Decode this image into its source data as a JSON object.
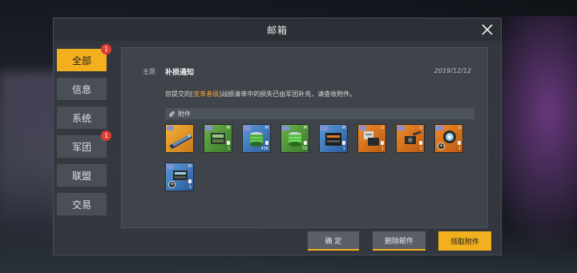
{
  "dialog": {
    "title": "邮箱",
    "close_icon": "close-icon"
  },
  "tabs": [
    {
      "label": "全部",
      "active": true,
      "badge": "1"
    },
    {
      "label": "信息",
      "active": false,
      "badge": ""
    },
    {
      "label": "系统",
      "active": false,
      "badge": ""
    },
    {
      "label": "军团",
      "active": false,
      "badge": "1"
    },
    {
      "label": "联盟",
      "active": false,
      "badge": ""
    },
    {
      "label": "交易",
      "active": false,
      "badge": ""
    }
  ],
  "mail": {
    "subject_label": "主题",
    "subject": "补损通知",
    "date": "2019/12/12",
    "message_prefix": "您提交的[",
    "message_highlight": "变革者级",
    "message_suffix": "]战损清单中的损失已由军团补充，请查收附件。",
    "attachment_label": "附件",
    "attachment_icon": "paperclip-icon"
  },
  "attachments": [
    {
      "name": "ship-blueprint-item",
      "rank": "",
      "qty": "",
      "color": "#f0a020"
    },
    {
      "name": "green-module-item",
      "rank": "M",
      "qty": "1",
      "color": "#4a9a3a"
    },
    {
      "name": "blue-coil-item",
      "rank": "M",
      "qty": "438",
      "color": "#3a78c0"
    },
    {
      "name": "green-coil-item",
      "rank": "M",
      "qty": "79",
      "color": "#4a9a3a"
    },
    {
      "name": "blue-engine-item",
      "rank": "M",
      "qty": "1",
      "color": "#3a78c0"
    },
    {
      "name": "orange-turret-item",
      "rank": "U",
      "qty": "1",
      "color": "#e07a1e"
    },
    {
      "name": "orange-cannon-item",
      "rank": "U",
      "qty": "1",
      "color": "#e07a1e"
    },
    {
      "name": "orange-core-item",
      "rank": "U",
      "qty": "1",
      "color": "#e07a1e"
    },
    {
      "name": "blue-core-item",
      "rank": "M",
      "qty": "1",
      "color": "#3a78c0"
    }
  ],
  "buttons": {
    "confirm": "确 定",
    "delete": "删除邮件",
    "claim": "领取附件"
  },
  "colors": {
    "accent": "#f2b01e",
    "badge": "#e03c32",
    "highlight_text": "#f2a33a"
  }
}
